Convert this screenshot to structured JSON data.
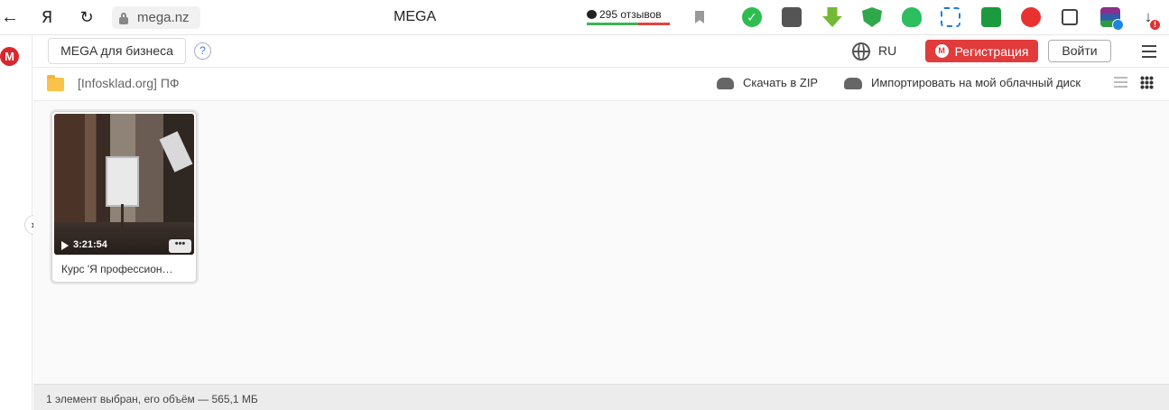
{
  "browser": {
    "yandex_glyph": "Я",
    "url": "mega.nz",
    "tab_title": "MEGA",
    "reviews_text": "295 отзывов"
  },
  "header": {
    "business_button": "MEGA для бизнеса",
    "help_glyph": "?",
    "language": "RU",
    "register_button": "Регистрация",
    "register_logo_letter": "M",
    "login_button": "Войти"
  },
  "sidebar": {
    "logo_letter": "M",
    "expand_glyph": "»"
  },
  "toolbar": {
    "breadcrumb": "[Infosklad.org] ПФ",
    "download_zip": "Скачать в ZIP",
    "import_cloud": "Импортировать на мой облачный диск"
  },
  "files": [
    {
      "name": "Курс 'Я профессион…",
      "duration": "3:21:54",
      "type": "video",
      "more_glyph": "•••"
    }
  ],
  "status": {
    "text": "1 элемент выбран, его объём — 565,1 МБ"
  },
  "icons": [
    "back-icon",
    "reload-icon",
    "lock-icon",
    "bookmark-icon",
    "globe-icon",
    "menu-icon",
    "folder-icon",
    "cloud-download-icon",
    "cloud-import-icon",
    "list-view-icon",
    "grid-view-icon",
    "play-icon"
  ],
  "colors": {
    "brand_red": "#e13b3b",
    "folder_yellow": "#f7c34a"
  }
}
